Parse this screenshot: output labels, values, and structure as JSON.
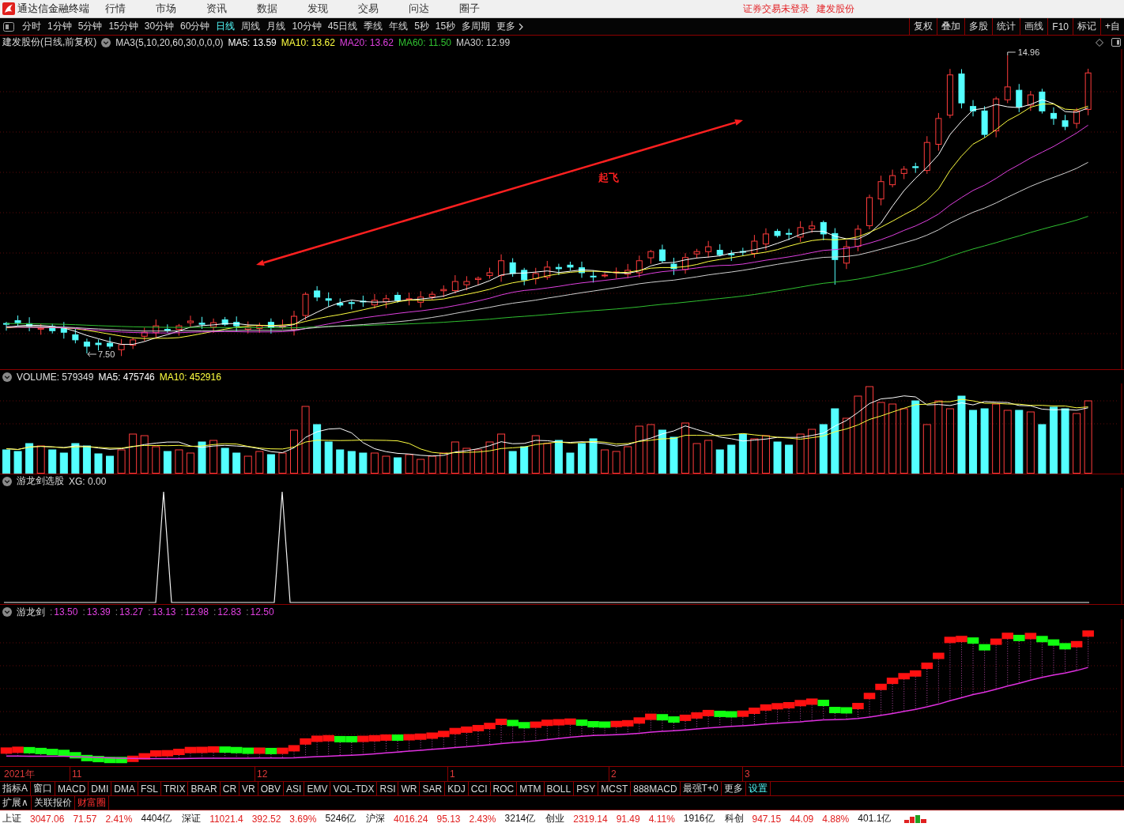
{
  "title_bar": {
    "app_name": "通达信金融终端",
    "menu": [
      "行情",
      "市场",
      "资讯",
      "数据",
      "发现",
      "交易",
      "问达",
      "圈子"
    ],
    "notices": [
      "证券交易未登录",
      "建发股份"
    ]
  },
  "period_bar": {
    "periods": [
      {
        "label": "分时",
        "selected": false,
        "kind": "period"
      },
      {
        "label": "1分钟",
        "selected": false,
        "kind": "period"
      },
      {
        "label": "5分钟",
        "selected": false,
        "kind": "period"
      },
      {
        "label": "15分钟",
        "selected": false,
        "kind": "period"
      },
      {
        "label": "30分钟",
        "selected": false,
        "kind": "period"
      },
      {
        "label": "60分钟",
        "selected": false,
        "kind": "period"
      },
      {
        "label": "日线",
        "selected": true,
        "kind": "period"
      },
      {
        "label": "周线",
        "selected": false,
        "kind": "period"
      },
      {
        "label": "月线",
        "selected": false,
        "kind": "period"
      },
      {
        "label": "10分钟",
        "selected": false,
        "kind": "period"
      },
      {
        "label": "45日线",
        "selected": false,
        "kind": "period"
      },
      {
        "label": "季线",
        "selected": false,
        "kind": "period"
      },
      {
        "label": "年线",
        "selected": false,
        "kind": "period"
      },
      {
        "label": "5秒",
        "selected": false,
        "kind": "period"
      },
      {
        "label": "15秒",
        "selected": false,
        "kind": "period"
      },
      {
        "label": "多周期",
        "selected": false,
        "kind": "period"
      },
      {
        "label": "更多",
        "selected": false,
        "kind": "menu"
      }
    ],
    "tools": [
      "复权",
      "叠加",
      "多股",
      "统计",
      "画线",
      "F10",
      "标记",
      "+自"
    ]
  },
  "main_chart": {
    "title": "建发股份(日线,前复权)",
    "indicator": "MA3(5,10,20,60,30,0,0,0)",
    "legend": [
      {
        "label": "MA5: 13.59",
        "color": "#ffffff"
      },
      {
        "label": "MA10: 13.62",
        "color": "#ffff40"
      },
      {
        "label": "MA20: 13.62",
        "color": "#e040e0"
      },
      {
        "label": "MA60: 11.50",
        "color": "#30c030"
      },
      {
        "label": "MA30: 12.99",
        "color": "#d0d0d0"
      }
    ],
    "annotation": "起飞",
    "high_label": "14.96",
    "low_label": "7.50"
  },
  "volume_panel": {
    "legend": [
      {
        "label": "VOLUME: 579349",
        "color": "#e0e0e0"
      },
      {
        "label": "MA5: 475746",
        "color": "#ffffff"
      },
      {
        "label": "MA10: 452916",
        "color": "#ffff40"
      }
    ]
  },
  "signal_panel": {
    "title": "游龙剑选股",
    "reading": "XG: 0.00"
  },
  "sword_panel": {
    "title": "游龙剑",
    "separator": ":",
    "values": [
      "13.50",
      "13.39",
      "13.27",
      "13.13",
      "12.98",
      "12.83",
      "12.50"
    ]
  },
  "date_axis": [
    "2021年",
    "11",
    "12",
    "1",
    "2",
    "3"
  ],
  "indicator_tabs": [
    {
      "label": "指标A",
      "kind": "tab"
    },
    {
      "label": "窗口",
      "kind": "tab"
    },
    {
      "label": "MACD",
      "kind": "tab"
    },
    {
      "label": "DMI",
      "kind": "tab"
    },
    {
      "label": "DMA",
      "kind": "tab"
    },
    {
      "label": "FSL",
      "kind": "tab"
    },
    {
      "label": "TRIX",
      "kind": "tab"
    },
    {
      "label": "BRAR",
      "kind": "tab"
    },
    {
      "label": "CR",
      "kind": "tab"
    },
    {
      "label": "VR",
      "kind": "tab"
    },
    {
      "label": "OBV",
      "kind": "tab"
    },
    {
      "label": "ASI",
      "kind": "tab"
    },
    {
      "label": "EMV",
      "kind": "tab"
    },
    {
      "label": "VOL-TDX",
      "kind": "tab"
    },
    {
      "label": "RSI",
      "kind": "tab"
    },
    {
      "label": "WR",
      "kind": "tab"
    },
    {
      "label": "SAR",
      "kind": "tab"
    },
    {
      "label": "KDJ",
      "kind": "tab"
    },
    {
      "label": "CCI",
      "kind": "tab"
    },
    {
      "label": "ROC",
      "kind": "tab"
    },
    {
      "label": "MTM",
      "kind": "tab"
    },
    {
      "label": "BOLL",
      "kind": "tab"
    },
    {
      "label": "PSY",
      "kind": "tab"
    },
    {
      "label": "MCST",
      "kind": "tab"
    },
    {
      "label": "888MACD",
      "kind": "tab"
    },
    {
      "label": "最强T+0",
      "kind": "tab"
    },
    {
      "label": "更多",
      "kind": "tab"
    },
    {
      "label": "设置",
      "kind": "settings"
    }
  ],
  "extension_tabs": [
    {
      "label": "扩展∧",
      "kind": "tab"
    },
    {
      "label": "关联报价",
      "kind": "tab"
    },
    {
      "label": "财富圈",
      "kind": "promo"
    }
  ],
  "status_bar": {
    "indices": [
      {
        "name": "上证",
        "value": "3047.06",
        "change": "71.57",
        "percent": "2.41%",
        "turnover": "4404亿",
        "rising": true
      },
      {
        "name": "深证",
        "value": "11021.4",
        "change": "392.52",
        "percent": "3.69%",
        "turnover": "5246亿",
        "rising": true
      },
      {
        "name": "沪深",
        "value": "4016.24",
        "change": "95.13",
        "percent": "2.43%",
        "turnover": "3214亿",
        "rising": true
      },
      {
        "name": "创业",
        "value": "2319.14",
        "change": "91.49",
        "percent": "4.11%",
        "turnover": "1916亿",
        "rising": true
      },
      {
        "name": "科创",
        "value": "947.15",
        "change": "44.09",
        "percent": "4.88%",
        "turnover": "401.1亿",
        "rising": true
      }
    ]
  }
}
